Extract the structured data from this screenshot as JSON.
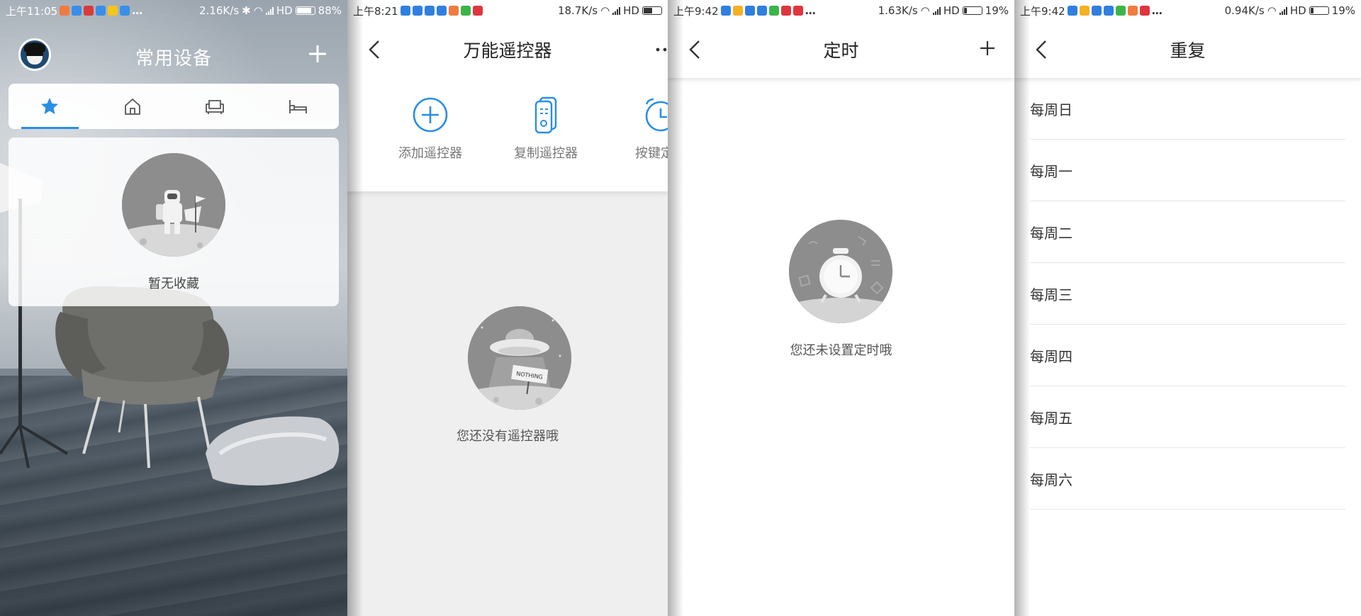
{
  "screens": {
    "home": {
      "status": {
        "time": "上午11:05",
        "net_speed": "2.16K/s",
        "hd": "HD",
        "battery": "88%",
        "battery_level": 0.88
      },
      "title": "常用设备",
      "tabs": [
        {
          "icon": "star-icon",
          "active": true
        },
        {
          "icon": "home-icon",
          "active": false
        },
        {
          "icon": "sofa-icon",
          "active": false
        },
        {
          "icon": "bed-icon",
          "active": false
        }
      ],
      "empty_text": "暂无收藏",
      "accent_color": "#2a8de6"
    },
    "remote": {
      "status": {
        "time": "上午8:21",
        "net_speed": "18.7K/s",
        "hd": "HD"
      },
      "title": "万能遥控器",
      "actions": [
        {
          "icon": "add-circle-icon",
          "label": "添加遥控器"
        },
        {
          "icon": "copy-remote-icon",
          "label": "复制遥控器"
        },
        {
          "icon": "alarm-clock-icon",
          "label": "按键定时"
        }
      ],
      "empty_text": "您还没有遥控器哦",
      "sign_text": "NOTHING"
    },
    "timer": {
      "status": {
        "time": "上午9:42",
        "net_speed": "1.63K/s",
        "hd": "HD",
        "battery": "19%",
        "battery_level": 0.19
      },
      "title": "定时",
      "empty_text": "您还未设置定时哦"
    },
    "repeat": {
      "status": {
        "time": "上午9:42",
        "net_speed": "0.94K/s",
        "hd": "HD",
        "battery": "19%",
        "battery_level": 0.19
      },
      "title": "重复",
      "items": [
        "每周日",
        "每周一",
        "每周二",
        "每周三",
        "每周四",
        "每周五",
        "每周六"
      ]
    }
  }
}
